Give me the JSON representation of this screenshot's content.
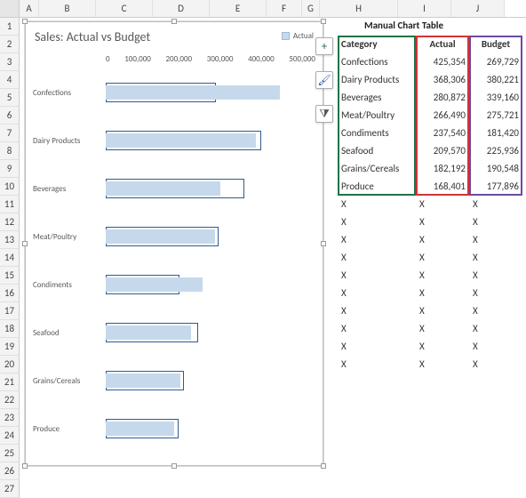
{
  "columns": [
    "A",
    "B",
    "C",
    "D",
    "E",
    "F",
    "G",
    "H",
    "I",
    "J"
  ],
  "rows": [
    "1",
    "2",
    "3",
    "4",
    "5",
    "6",
    "7",
    "8",
    "9",
    "10",
    "11",
    "12",
    "13",
    "14",
    "15",
    "16",
    "17",
    "18",
    "19",
    "20",
    "21",
    "22",
    "23",
    "24",
    "25",
    "26",
    "27"
  ],
  "chart": {
    "title": "Sales: Actual vs Budget",
    "legend_label": "Actual",
    "axis_ticks": [
      "0",
      "100,000",
      "200,000",
      "300,000",
      "400,000",
      "500,000"
    ]
  },
  "chart_data": {
    "type": "bar",
    "orientation": "horizontal",
    "title": "Sales: Actual vs Budget",
    "xlabel": "",
    "ylabel": "",
    "xlim": [
      0,
      500000
    ],
    "categories": [
      "Confections",
      "Dairy Products",
      "Beverages",
      "Meat/Poultry",
      "Condiments",
      "Seafood",
      "Grains/Cereals",
      "Produce"
    ],
    "series": [
      {
        "name": "Actual",
        "values": [
          425354,
          368306,
          280872,
          266490,
          237540,
          209570,
          182192,
          168401
        ]
      },
      {
        "name": "Budget",
        "values": [
          269729,
          380221,
          339160,
          275721,
          181420,
          225936,
          190548,
          177896
        ]
      }
    ]
  },
  "table": {
    "title": "Manual Chart Table",
    "headers": {
      "cat": "Category",
      "actual": "Actual",
      "budget": "Budget"
    },
    "rows": [
      {
        "cat": "Confections",
        "actual": "425,354",
        "budget": "269,729"
      },
      {
        "cat": "Dairy Products",
        "actual": "368,306",
        "budget": "380,221"
      },
      {
        "cat": "Beverages",
        "actual": "280,872",
        "budget": "339,160"
      },
      {
        "cat": "Meat/Poultry",
        "actual": "266,490",
        "budget": "275,721"
      },
      {
        "cat": "Condiments",
        "actual": "237,540",
        "budget": "181,420"
      },
      {
        "cat": "Seafood",
        "actual": "209,570",
        "budget": "225,936"
      },
      {
        "cat": "Grains/Cereals",
        "actual": "182,192",
        "budget": "190,548"
      },
      {
        "cat": "Produce",
        "actual": "168,401",
        "budget": "177,896"
      }
    ],
    "x_placeholder": "X",
    "x_count": 10
  },
  "context_icons": {
    "plus": "+",
    "brush": "🖌",
    "funnel": "⧩"
  }
}
